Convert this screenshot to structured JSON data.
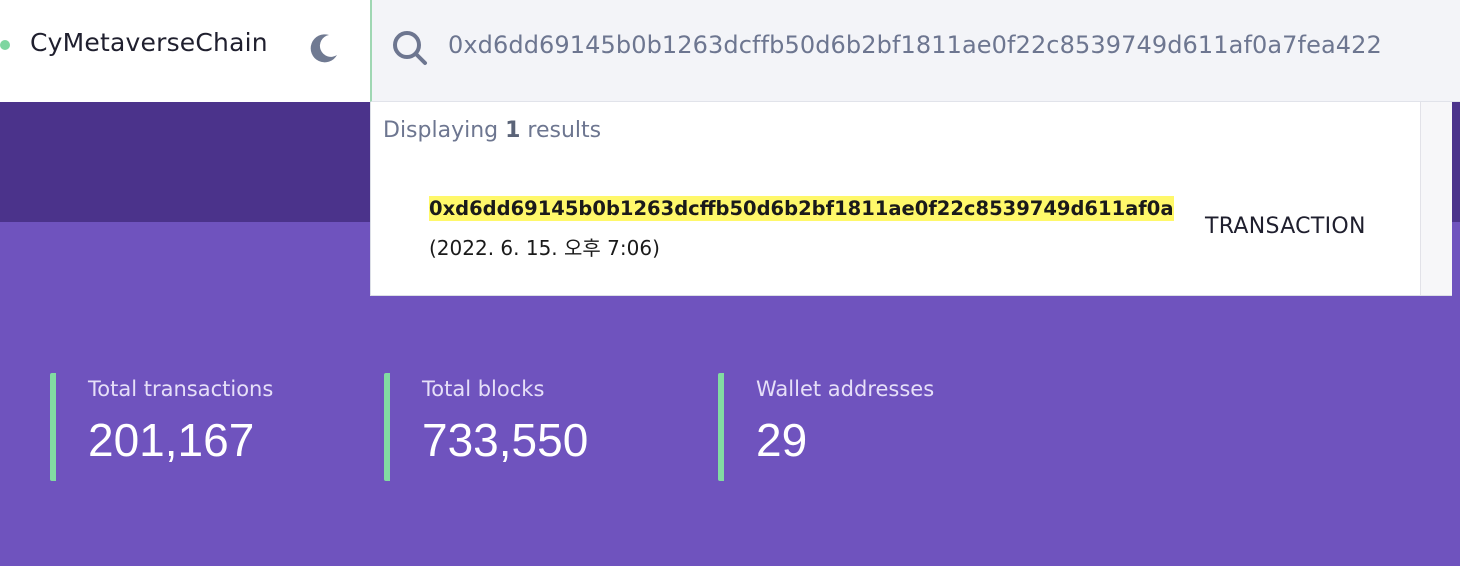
{
  "header": {
    "network_name": "CyMetaverseChain",
    "theme_icon": "moon-icon"
  },
  "search": {
    "value": "0xd6dd69145b0b1263dcffb50d6b2bf1811ae0f22c8539749d611af0a7fea422",
    "icon": "search-icon"
  },
  "dropdown": {
    "prefix": "Displaying ",
    "count": "1",
    "suffix": " results",
    "results": [
      {
        "hash": "0xd6dd69145b0b1263dcffb50d6b2bf1811ae0f22c8539749d611af0a",
        "time": "(2022. 6. 15. 오후 7:06)",
        "type": "TRANSACTION"
      }
    ]
  },
  "stats": [
    {
      "label": "Total transactions",
      "value": "201,167"
    },
    {
      "label": "Total blocks",
      "value": "733,550"
    },
    {
      "label": "Wallet addresses",
      "value": "29"
    }
  ],
  "colors": {
    "accent_green": "#82dba2",
    "background_purple": "#6f53be",
    "dark_band": "#4b338b",
    "highlight": "#fff86a"
  }
}
